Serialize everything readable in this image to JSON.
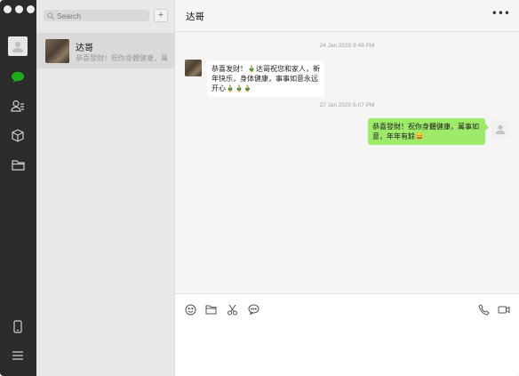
{
  "sidebar": {
    "icons": [
      "profile-avatar",
      "chats-icon",
      "contacts-icon",
      "favorites-icon",
      "files-icon",
      "phone-icon",
      "menu-icon"
    ],
    "accent": "#1aad19"
  },
  "list": {
    "search_placeholder": "Search",
    "add_label": "+",
    "chats": [
      {
        "name": "达哥",
        "preview": "恭喜發財！祝你身體健康，萬"
      }
    ]
  },
  "chat": {
    "title": "达哥",
    "more_label": "•••",
    "messages": [
      {
        "timestamp": "24 Jan 2020 9:49 PM",
        "side": "left",
        "text": "恭喜发财！🎍达哥祝您和家人，新年快乐，身体健康，事事如意永远开心🎍🎍🎍"
      },
      {
        "timestamp": "27 Jan 2020 6:07 PM",
        "side": "right",
        "text": "恭喜發財！祝你身體健康，萬事如意，年年有餘😄"
      }
    ],
    "bubble_colors": {
      "incoming": "#ffffff",
      "outgoing": "#9eea6a"
    },
    "tools_left": [
      "emoji-icon",
      "folder-icon",
      "scissors-icon",
      "chat-bubble-icon"
    ],
    "tools_right": [
      "phone-call-icon",
      "video-call-icon"
    ]
  }
}
